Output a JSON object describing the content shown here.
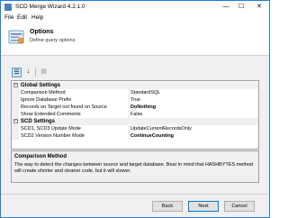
{
  "window": {
    "title": "SCD Merge Wizard 4.2.1.0",
    "min_glyph": "—",
    "max_glyph": "☐",
    "close_glyph": "✕"
  },
  "menu": [
    {
      "label": "File"
    },
    {
      "label": "Edit"
    },
    {
      "label": "Help"
    }
  ],
  "header": {
    "title": "Options",
    "subtitle": "Define query options"
  },
  "toolbar": {
    "categorized_glyph": "☰",
    "alphabetical_glyph": "↓",
    "property_pages_glyph": "▤"
  },
  "grid": {
    "categories": [
      {
        "label": "Global Settings",
        "expanded_glyph": "−"
      },
      {
        "label": "SCD Settings",
        "expanded_glyph": "−"
      }
    ],
    "global_props": [
      {
        "name": "Comparison Method",
        "value": "StandardSQL"
      },
      {
        "name": "Ignore Database Prefix",
        "value": "True"
      },
      {
        "name": "Records on Target not found on Source",
        "value": "DoNothing"
      },
      {
        "name": "Show Extended Comments",
        "value": "False"
      }
    ],
    "scd_props": [
      {
        "name": "SCD1, SCD3 Update Mode",
        "value": "UpdateCurrentRecordsOnly"
      },
      {
        "name": "SCD2 Version Number Mode",
        "value": "ContinueCounting"
      }
    ]
  },
  "description": {
    "title": "Comparison Method",
    "text": "The way to detect the changes between source and target database. Bear in mind that HASHBYTES method will create shorter and cleaner code, but it will slower."
  },
  "buttons": {
    "back": "Back",
    "next": "Next",
    "cancel": "Cancel"
  }
}
